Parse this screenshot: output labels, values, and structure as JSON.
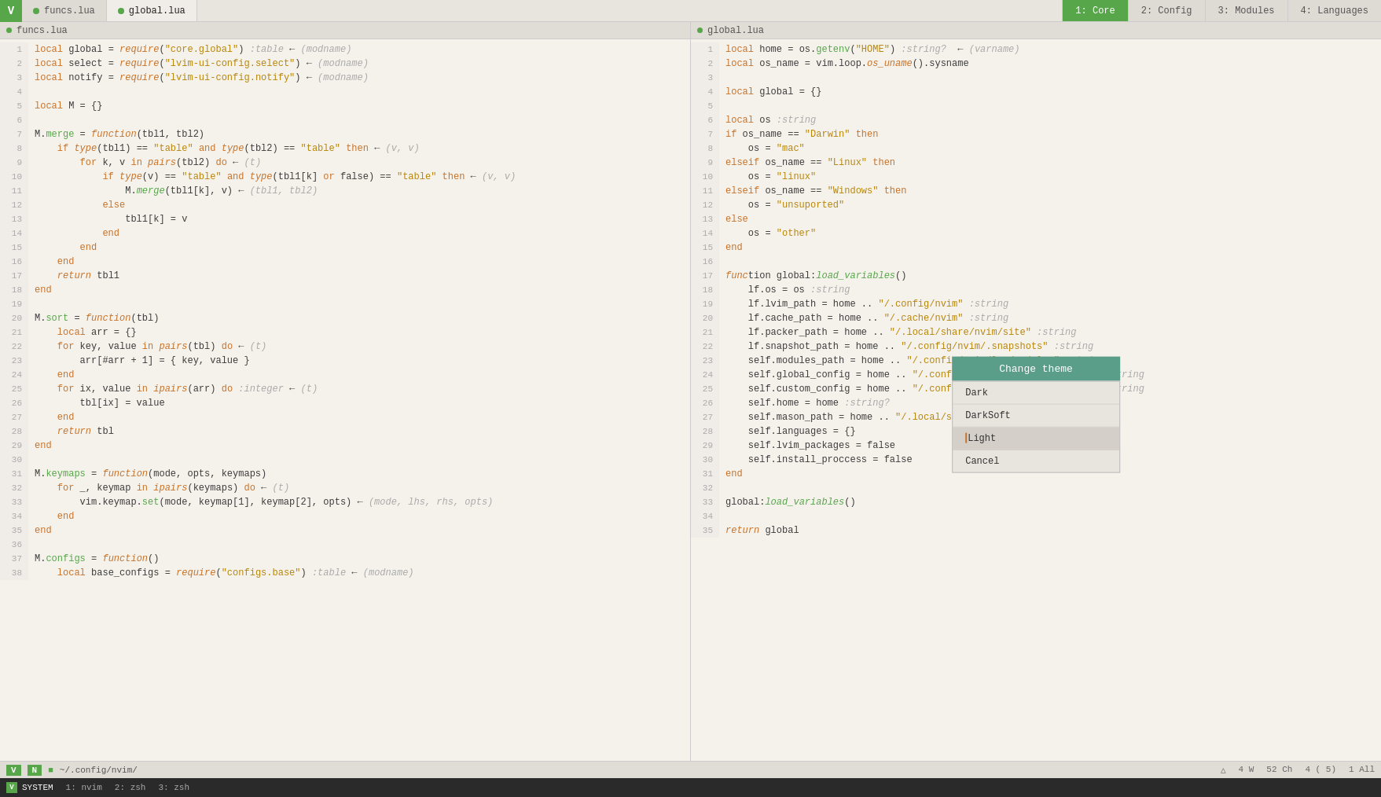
{
  "topBar": {
    "logo": "V",
    "fileTabs": [
      {
        "label": "funcs.lua",
        "active": false
      },
      {
        "label": "global.lua",
        "active": true
      }
    ],
    "rightTabs": [
      {
        "id": "1",
        "label": "1: Core",
        "active": true
      },
      {
        "id": "2",
        "label": "2: Config",
        "active": false
      },
      {
        "id": "3",
        "label": "3: Modules",
        "active": false
      },
      {
        "id": "4",
        "label": "4: Languages",
        "active": false
      }
    ]
  },
  "leftPane": {
    "filename": "funcs.lua"
  },
  "rightPane": {
    "filename": "global.lua"
  },
  "dropdown": {
    "title": "Change theme",
    "items": [
      {
        "label": "Dark",
        "selected": false
      },
      {
        "label": "DarkSoft",
        "selected": false
      },
      {
        "label": "Light",
        "selected": true,
        "cursor": true
      },
      {
        "label": "Cancel",
        "selected": false
      }
    ]
  },
  "statusBar": {
    "mode": "N",
    "logo": "V",
    "path": "~/.config/nvim/",
    "warnings": "4 W",
    "chars": "52 Ch",
    "position": "4 ( 5)",
    "count": "1 All"
  },
  "terminalBar": {
    "tabs": [
      {
        "label": "SYSTEM",
        "active": true
      },
      {
        "num": "1:",
        "name": "nvim",
        "active": false
      },
      {
        "num": "2:",
        "name": "zsh",
        "active": false
      },
      {
        "num": "3:",
        "name": "zsh",
        "active": false
      }
    ]
  }
}
